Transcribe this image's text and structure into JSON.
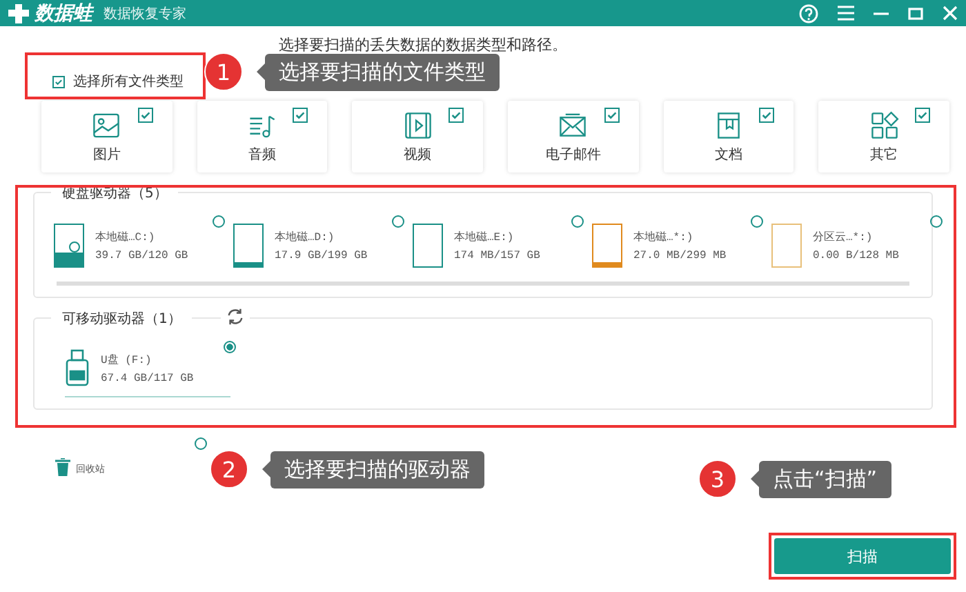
{
  "window": {
    "app_name": "数据蛙",
    "subtitle": "数据恢复专家"
  },
  "instruction": "选择要扫描的丢失数据的数据类型和路径。",
  "select_all": {
    "label": "选择所有文件类型",
    "checked": true
  },
  "file_types": [
    {
      "kind": "image",
      "label": "图片",
      "checked": true
    },
    {
      "kind": "audio",
      "label": "音频",
      "checked": true
    },
    {
      "kind": "video",
      "label": "视频",
      "checked": true
    },
    {
      "kind": "email",
      "label": "电子邮件",
      "checked": true
    },
    {
      "kind": "document",
      "label": "文档",
      "checked": true
    },
    {
      "kind": "other",
      "label": "其它",
      "checked": true
    }
  ],
  "hard_drives": {
    "title": "硬盘驱动器（5）",
    "drives": [
      {
        "kind": "system",
        "name": "本地磁…C:)",
        "size": "39.7 GB/120 GB",
        "level": 0.33,
        "color": "#1a9087",
        "selected": false
      },
      {
        "kind": "disk",
        "name": "本地磁…D:)",
        "size": "17.9 GB/199 GB",
        "level": 0.09,
        "color": "#1a9087",
        "selected": false
      },
      {
        "kind": "disk",
        "name": "本地磁…E:)",
        "size": "174 MB/157 GB",
        "color": "#1a9087",
        "selected": false
      },
      {
        "kind": "disk",
        "name": "本地磁…*:)",
        "size": "27.0 MB/299 MB",
        "level": 0.09,
        "color": "#e08a1e",
        "selected": false
      },
      {
        "kind": "disk",
        "name": "分区云…*:)",
        "size": "0.00  B/128 MB",
        "color": "#e8c07a",
        "selected": false
      }
    ]
  },
  "removable_drives": {
    "title": "可移动驱动器（1）",
    "drives": [
      {
        "kind": "usb",
        "name": "U盘 (F:)",
        "size": "67.4 GB/117 GB",
        "selected": true
      }
    ]
  },
  "recycle_bin": {
    "label": "回收站",
    "selected": false
  },
  "scan_button": "扫描",
  "callouts": [
    {
      "number": "1",
      "text": "选择要扫描的文件类型"
    },
    {
      "number": "2",
      "text": "选择要扫描的驱动器"
    },
    {
      "number": "3",
      "text": "点击“扫描”"
    }
  ]
}
